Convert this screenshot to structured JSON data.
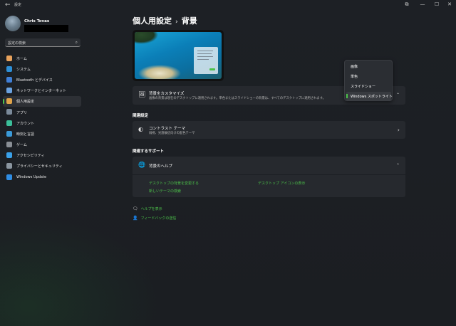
{
  "window": {
    "title": "設定",
    "back_glyph": "←",
    "controls": {
      "extra": "⧉",
      "minimize": "—",
      "maximize": "☐",
      "close": "✕"
    }
  },
  "user": {
    "name": "Chris Tovas"
  },
  "search": {
    "placeholder": "設定の検索",
    "icon": "search-icon",
    "glyph": "⌕"
  },
  "sidebar": {
    "items": [
      {
        "label": "ホーム",
        "icon": "home-icon",
        "color": "#e8a25c"
      },
      {
        "label": "システム",
        "icon": "system-icon",
        "color": "#2e8fd6"
      },
      {
        "label": "Bluetooth とデバイス",
        "icon": "bluetooth-icon",
        "color": "#3f7fd6"
      },
      {
        "label": "ネットワークとインターネット",
        "icon": "network-icon",
        "color": "#6aa2e0"
      },
      {
        "label": "個人用設定",
        "icon": "personalization-icon",
        "color": "#e0a44a",
        "selected": true
      },
      {
        "label": "アプリ",
        "icon": "apps-icon",
        "color": "#7b8a9a"
      },
      {
        "label": "アカウント",
        "icon": "accounts-icon",
        "color": "#3bbf9a"
      },
      {
        "label": "時刻と言語",
        "icon": "time-language-icon",
        "color": "#3a9ad9"
      },
      {
        "label": "ゲーム",
        "icon": "gaming-icon",
        "color": "#8a8f96"
      },
      {
        "label": "アクセシビリティ",
        "icon": "accessibility-icon",
        "color": "#3aa0e8"
      },
      {
        "label": "プライバシーとセキュリティ",
        "icon": "privacy-icon",
        "color": "#8a95a0"
      },
      {
        "label": "Windows Update",
        "icon": "windows-update-icon",
        "color": "#2f8de4"
      }
    ]
  },
  "header": {
    "parent": "個人用設定",
    "separator": "›",
    "current": "背景"
  },
  "background_card": {
    "title": "背景をカスタマイズ",
    "subtitle": "画像の背景は現在のデスクトップに適用されます。単色またはスライドショーの背景は、すべてのデスクトップに適用されます。",
    "icon_glyph": "🖼",
    "chevron": "⌃"
  },
  "dropdown": {
    "options": [
      "画像",
      "単色",
      "スライドショー",
      "Windows スポットライト"
    ],
    "selected_index": 3
  },
  "related_settings": {
    "label": "関連設定",
    "contrast": {
      "title": "コントラスト テーマ",
      "subtitle": "弱視、光過敏症向けの配色テーマ",
      "icon_glyph": "◐",
      "chevron": "›"
    }
  },
  "related_support": {
    "label": "関連するサポート",
    "help": {
      "title": "背景のヘルプ",
      "icon_glyph": "🌐",
      "chevron": "⌃",
      "links": [
        "デスクトップの背景を変更する",
        "デスクトップ アイコンの表示",
        "新しいテーマの検索"
      ]
    }
  },
  "footer": {
    "get_help": {
      "label": "ヘルプを表示",
      "glyph": "🗨"
    },
    "feedback": {
      "label": "フィードバックの送信",
      "glyph": "👤"
    }
  },
  "colors": {
    "accent": "#4cc24a",
    "card_bg": "#26292e",
    "page_bg": "#1c1f24"
  }
}
